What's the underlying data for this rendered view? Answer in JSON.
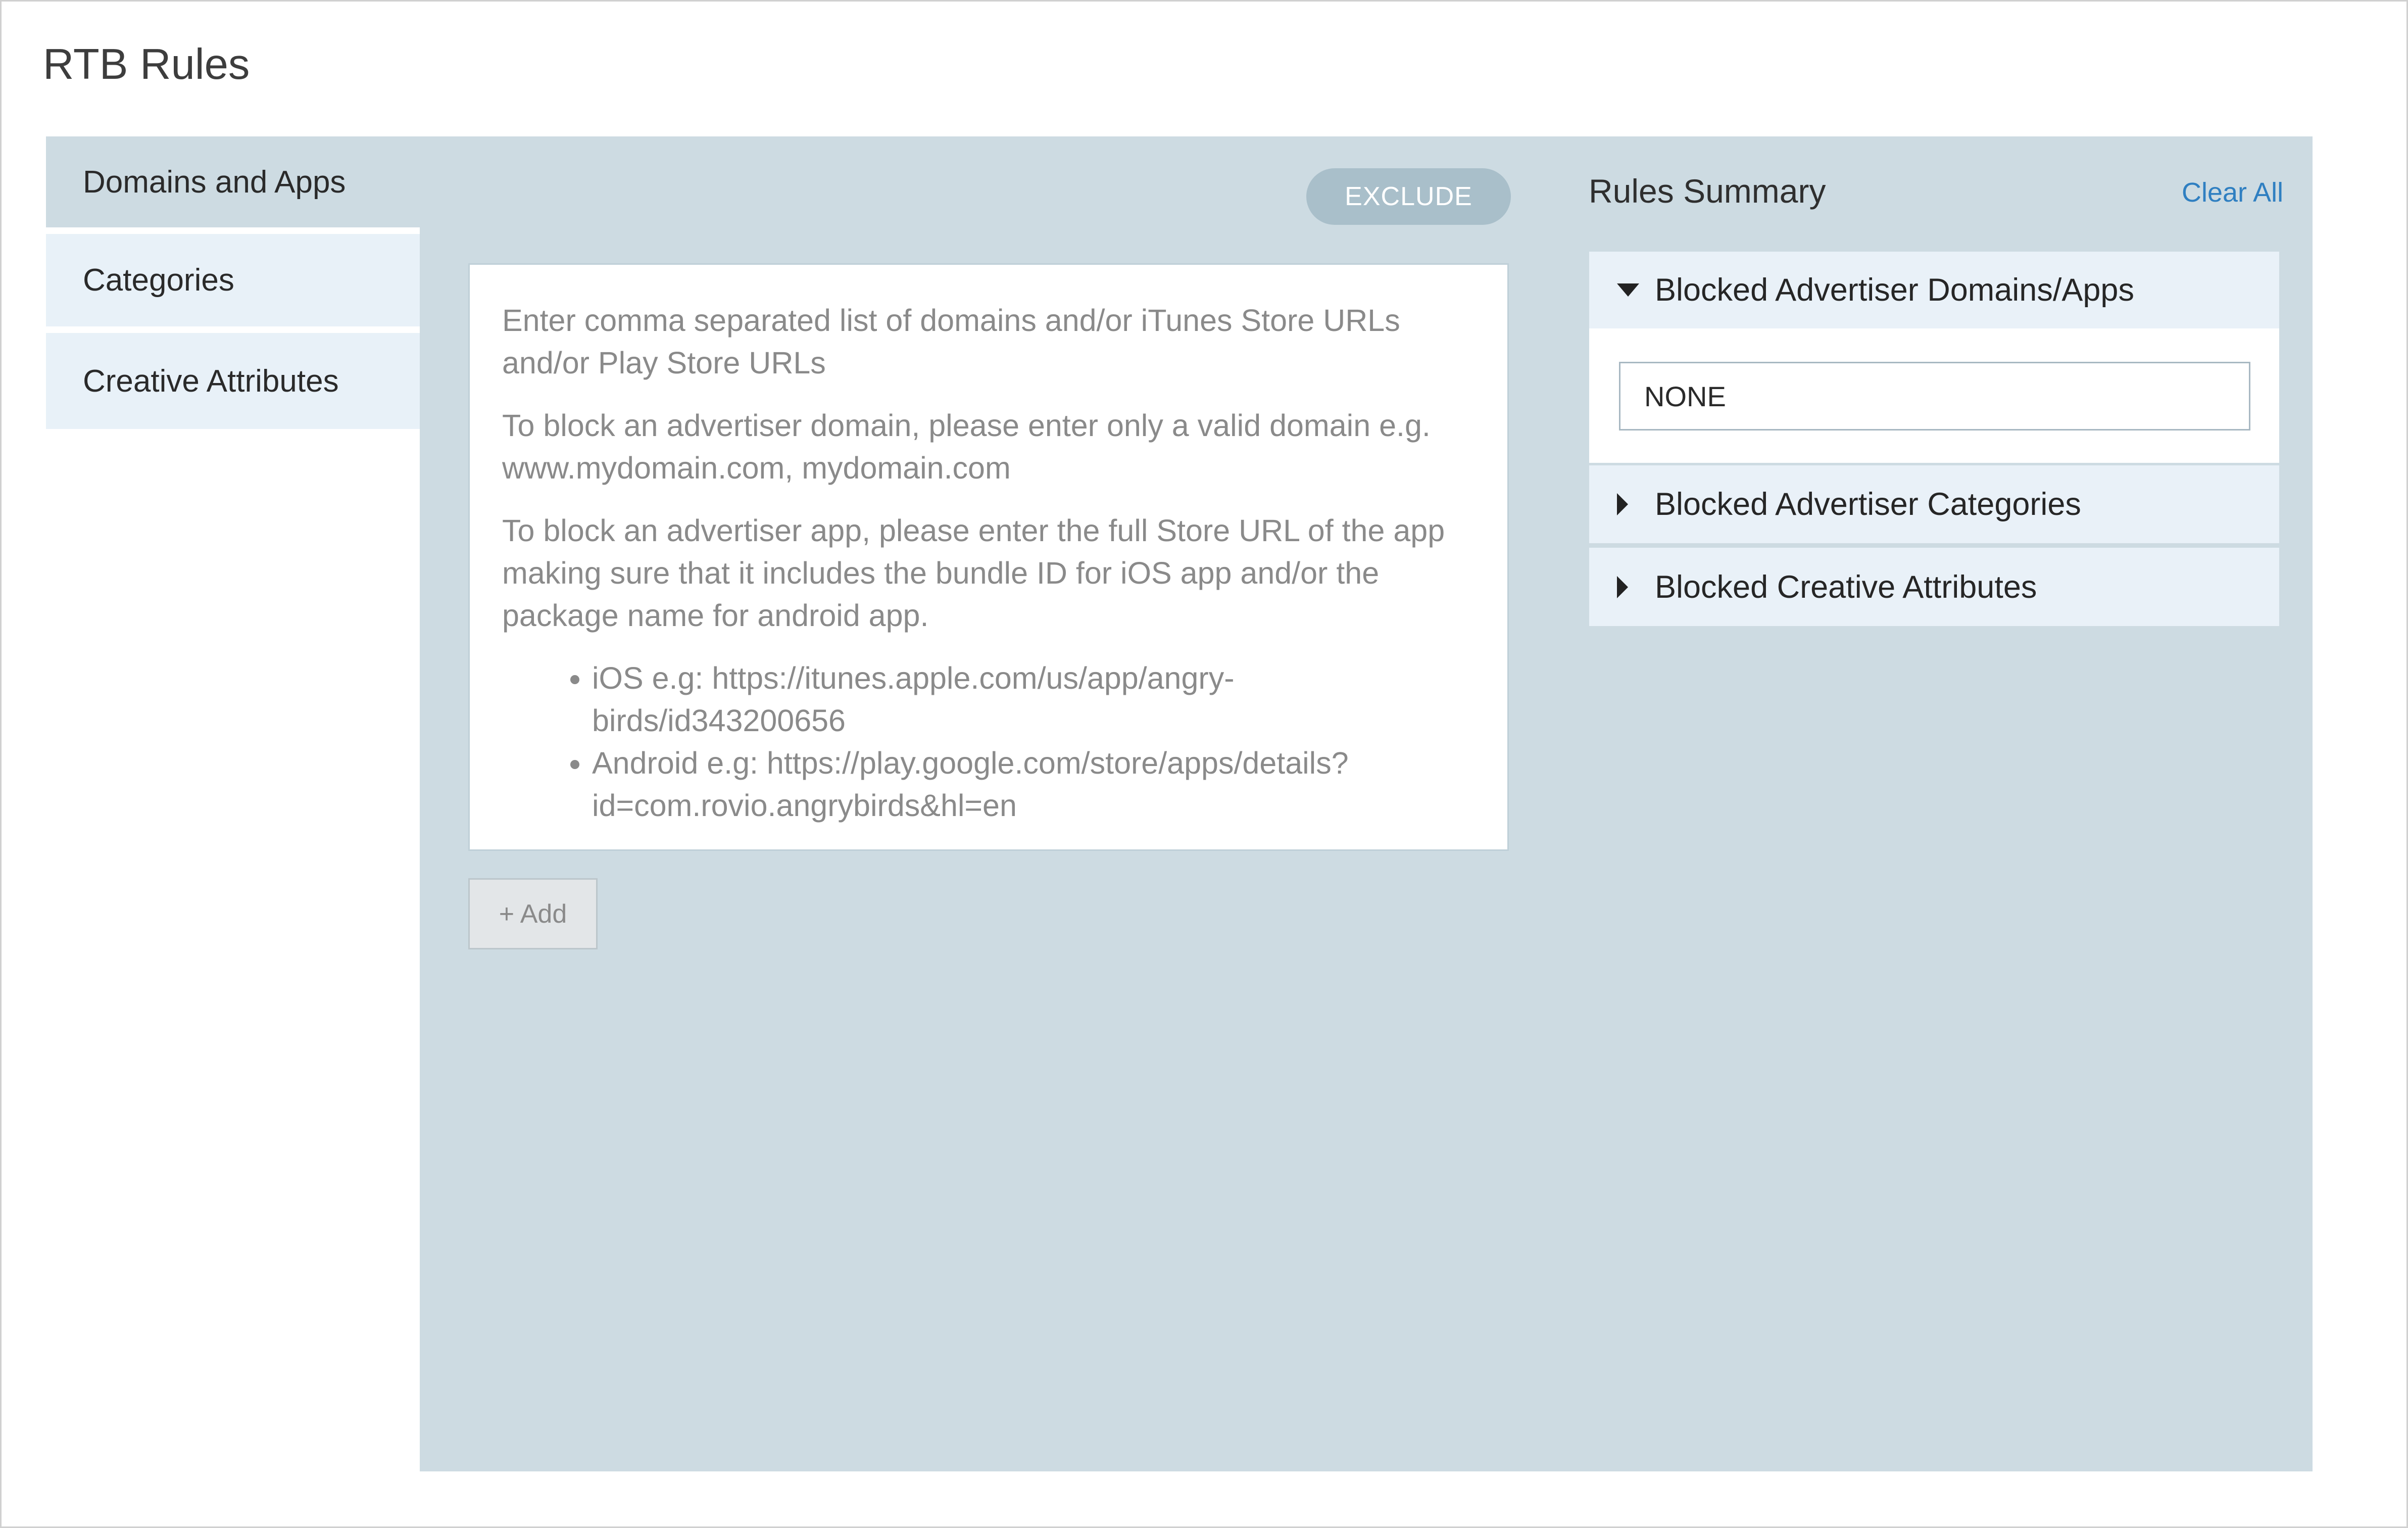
{
  "page": {
    "title": "RTB Rules"
  },
  "sidebar": {
    "items": [
      {
        "label": "Domains and Apps",
        "active": true
      },
      {
        "label": "Categories",
        "active": false
      },
      {
        "label": "Creative Attributes",
        "active": false
      }
    ]
  },
  "editor": {
    "mode_button": "EXCLUDE",
    "instructions": [
      "Enter comma separated list of domains and/or iTunes Store URLs and/or Play Store URLs",
      "To block an advertiser domain, please enter only a valid domain e.g. www.mydomain.com, mydomain.com",
      "To block an advertiser app, please enter the full Store URL of the app making sure that it includes the bundle ID for iOS app and/or the package name for android app."
    ],
    "examples": [
      "iOS e.g: https://itunes.apple.com/us/app/angry-birds/id343200656",
      "Android e.g: https://play.google.com/store/apps/details?id=com.rovio.angrybirds&hl=en"
    ],
    "add_button": "+ Add"
  },
  "summary": {
    "title": "Rules Summary",
    "clear_all": "Clear All",
    "sections": [
      {
        "label": "Blocked Advertiser Domains/Apps",
        "expanded": true,
        "value": "NONE",
        "icon": "caret-down-icon"
      },
      {
        "label": "Blocked Advertiser Categories",
        "expanded": false,
        "icon": "caret-right-icon"
      },
      {
        "label": "Blocked Creative Attributes",
        "expanded": false,
        "icon": "caret-right-icon"
      }
    ]
  },
  "colors": {
    "panel_bg": "#cddbe2",
    "tab_bg": "#e8f1f8",
    "exclude_button": "#a9bfca",
    "link": "#2f7fc1"
  }
}
